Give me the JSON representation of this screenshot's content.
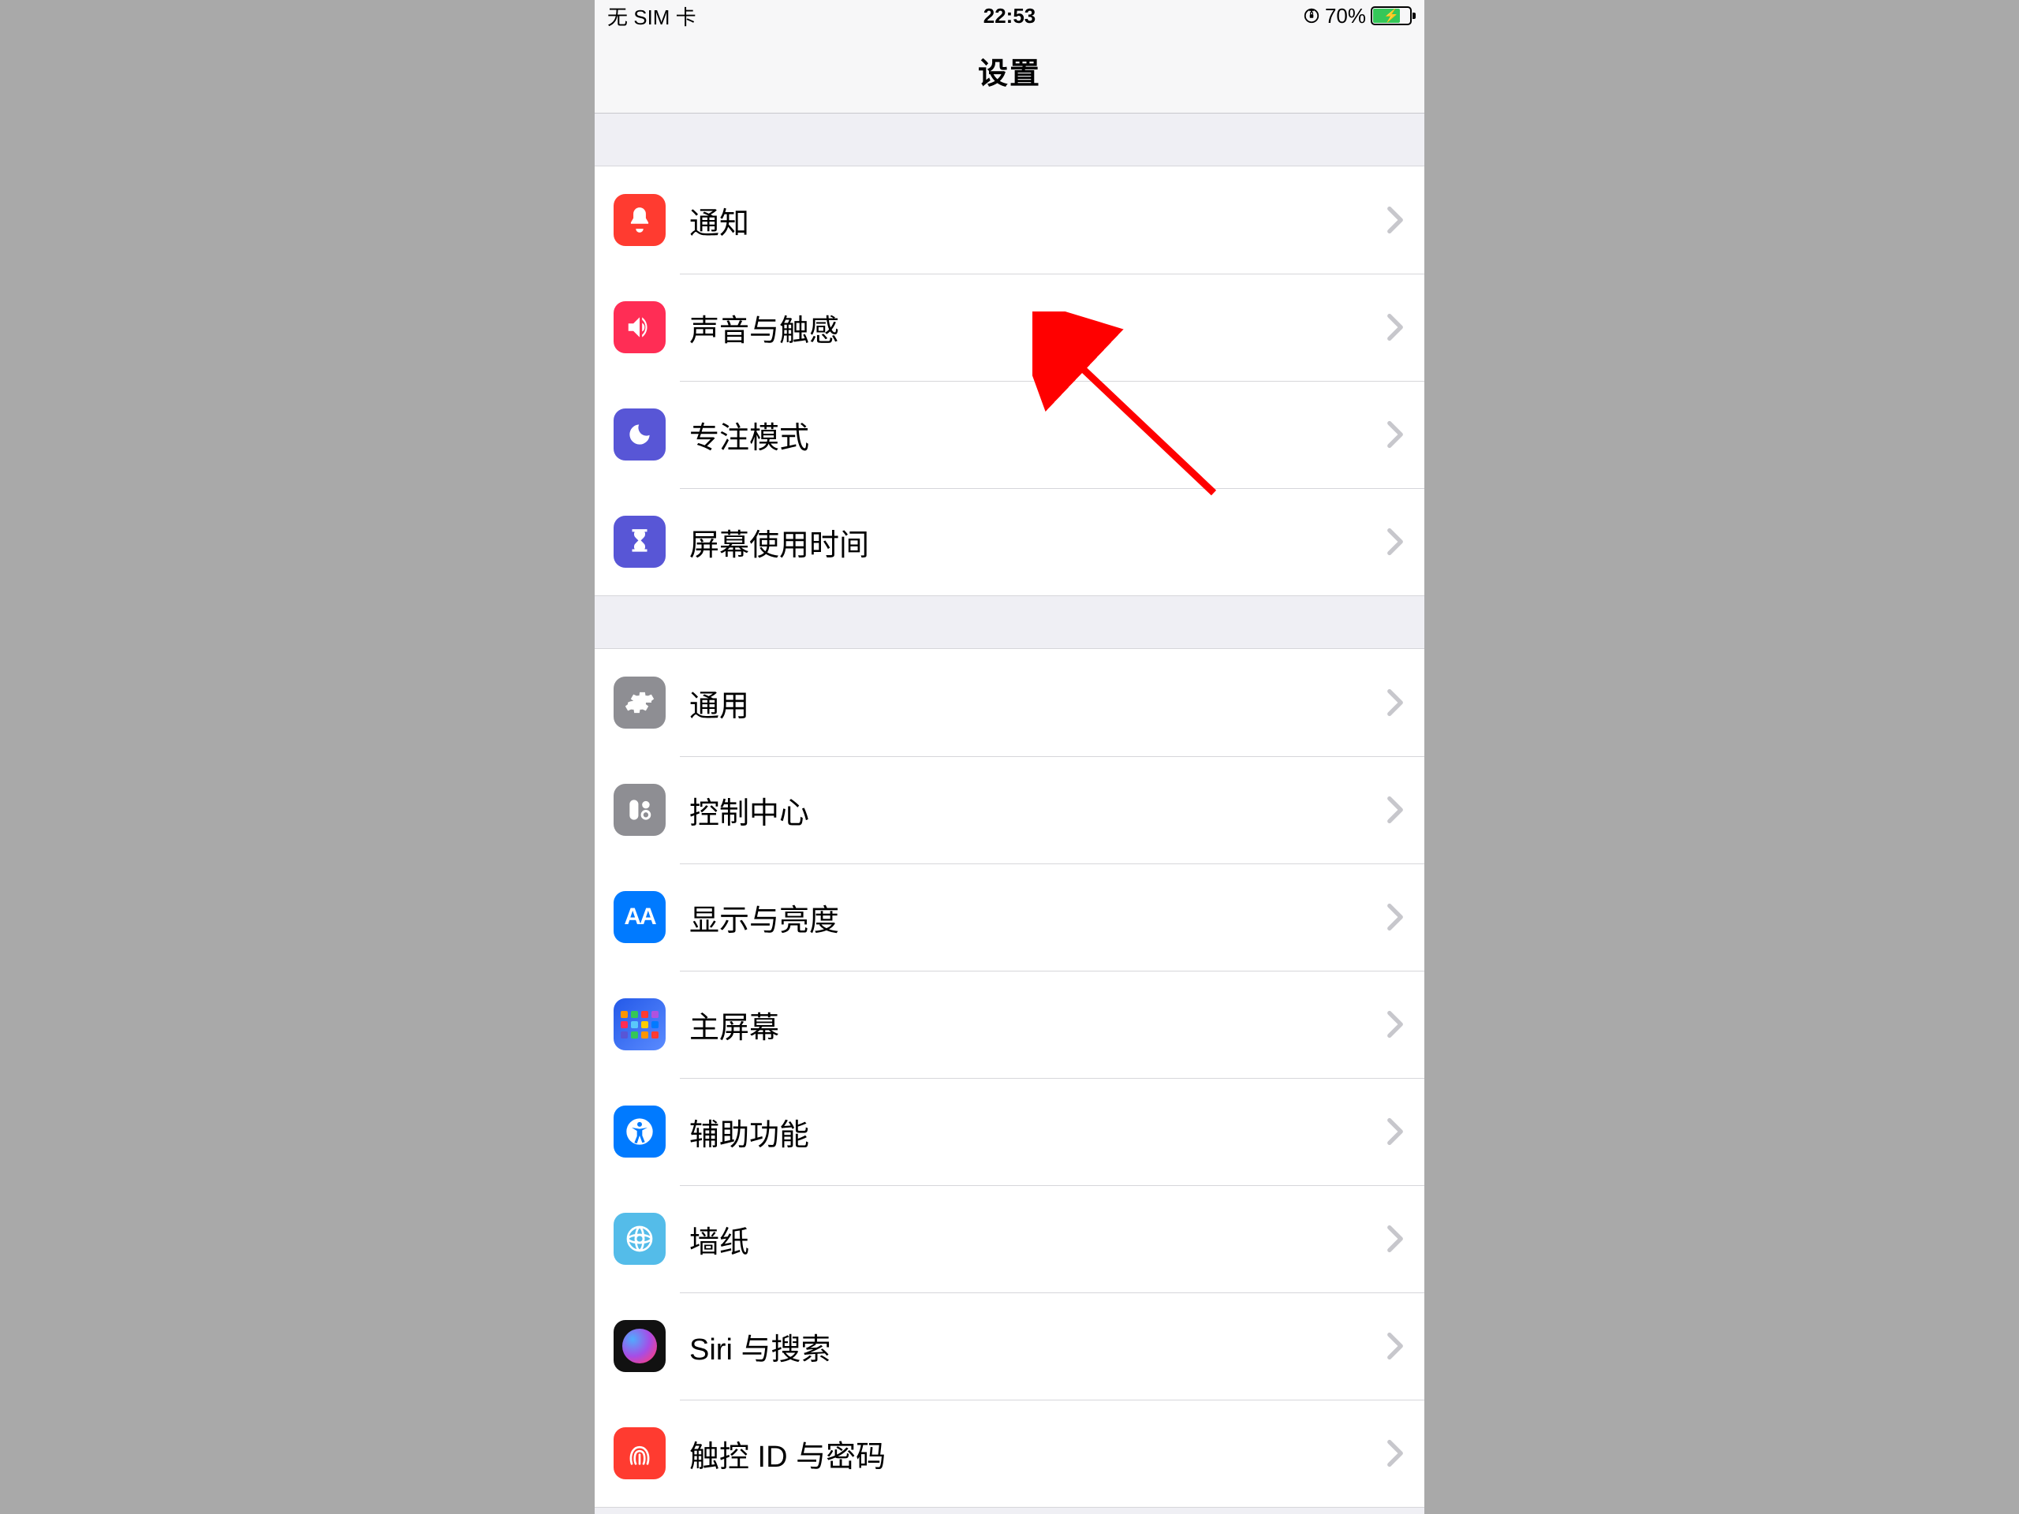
{
  "status": {
    "carrier": "无 SIM 卡",
    "time": "22:53",
    "battery_pct": "70%"
  },
  "header": {
    "title": "设置"
  },
  "group1": {
    "items": [
      {
        "label": "通知"
      },
      {
        "label": "声音与触感"
      },
      {
        "label": "专注模式"
      },
      {
        "label": "屏幕使用时间"
      }
    ]
  },
  "group2": {
    "items": [
      {
        "label": "通用"
      },
      {
        "label": "控制中心"
      },
      {
        "label": "显示与亮度"
      },
      {
        "label": "主屏幕"
      },
      {
        "label": "辅助功能"
      },
      {
        "label": "墙纸"
      },
      {
        "label": "Siri 与搜索"
      },
      {
        "label": "触控 ID 与密码"
      }
    ]
  }
}
